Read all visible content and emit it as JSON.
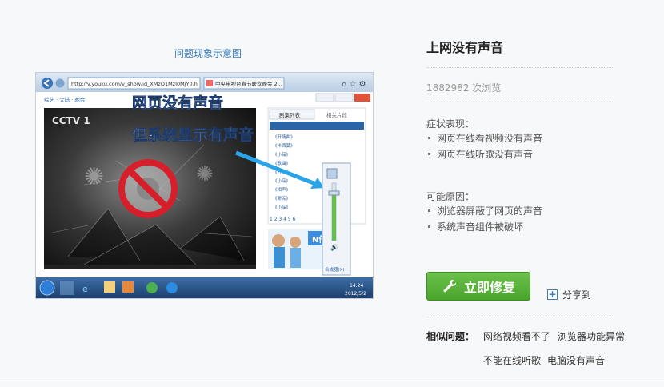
{
  "left": {
    "caption": "问题现象示意图",
    "screenshot": {
      "url_text": "http://v.youku.com/v_show/id_XMzQ1MzI0MjY0.h",
      "tab_text": "中央电视台春节联欢晚会 2...",
      "nav_crumb": "综艺 · 大陆 · 晚会",
      "overlay_line1": "网页没有声音",
      "overlay_line2": "但系统显示有声音",
      "tab_playlist": "剧集列表",
      "tab_related": "相关片段",
      "top_tabs": [
        "首页",
        "新歌"
      ],
      "page_numbers": "1 2 3 4 5 6",
      "mixer_label": "合成器(X)",
      "clock_time": "14:24",
      "clock_date": "2012/5/2",
      "brand_left": "CCTV 1",
      "ad_text": "N倍"
    }
  },
  "right": {
    "title": "上网没有声音",
    "views_count": "1882982",
    "views_suffix": " 次浏览",
    "symptoms_heading": "症状表现：",
    "symptoms": [
      "网页在线看视频没有声音",
      "网页在线听歌没有声音"
    ],
    "causes_heading": "可能原因：",
    "causes": [
      "浏览器屏蔽了网页的声音",
      "系统声音组件被破坏"
    ],
    "repair_label": "立即修复",
    "share_label": "分享到",
    "related_heading": "相似问题：",
    "related": [
      "网络视频看不了",
      "浏览器功能异常",
      "不能在线听歌",
      "电脑没有声音"
    ]
  },
  "colors": {
    "link_blue": "#3a7ebf",
    "repair_green": "#4aa52b"
  }
}
